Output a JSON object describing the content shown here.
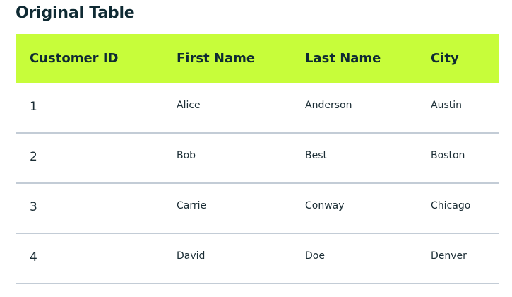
{
  "title": "Original Table",
  "table": {
    "headers": [
      "Customer ID",
      "First Name",
      "Last Name",
      "City"
    ],
    "rows": [
      [
        "1",
        "Alice",
        "Anderson",
        "Austin"
      ],
      [
        "2",
        "Bob",
        "Best",
        "Boston"
      ],
      [
        "3",
        "Carrie",
        "Conway",
        "Chicago"
      ],
      [
        "4",
        "David",
        "Doe",
        "Denver"
      ]
    ]
  },
  "colors": {
    "header_background": "#c7fd3a",
    "text": "#0f2a33",
    "row_divider": "#c3ccd6"
  }
}
